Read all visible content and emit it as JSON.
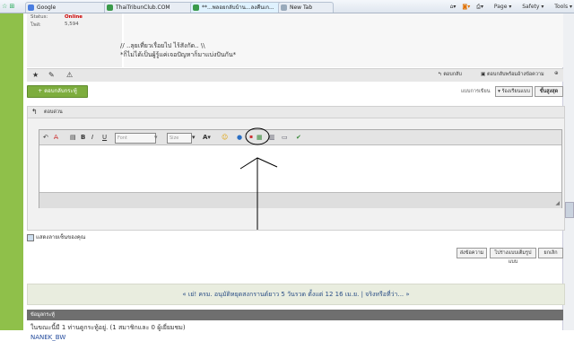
{
  "browser": {
    "tabs": [
      {
        "label": "Google"
      },
      {
        "label": "ThaiTribunClub.COM"
      },
      {
        "label": "**...พลอยกลับบ้าน...ลงคืนเก..."
      },
      {
        "label": "New Tab"
      }
    ],
    "tools": [
      "Page",
      "Safety",
      "Tools"
    ]
  },
  "user_panel": {
    "status_label": "Status:",
    "status_value": "Online",
    "posts_label": "โพส:",
    "posts_value": "5,594"
  },
  "signature": {
    "line1": "// ..ลุยเที่ยวเรื่อยไป ไร้สังกัด.. \\\\",
    "line2": "*ก็ไม่ได้เป็นผู้รู้แค่เจอปัญหาก็มาแบ่งปันกัน*"
  },
  "post_bar": {
    "quote_label": "ตอบกลับ",
    "multi_quote_label": "ตอบกลับพร้อมอ้างข้อความ"
  },
  "actions": {
    "new_reply_label": "+ ตอบกลับกระทู้",
    "mode_label": "แบบการเขียน",
    "mode_basic": "▾ ร้องเรียนแบบ",
    "mode_advanced": "ขั้นสูงสุด"
  },
  "quick_reply": {
    "title": "ตอบด่วน"
  },
  "editor_toolbar": {
    "font_placeholder": "Font",
    "size_placeholder": "Size"
  },
  "options": {
    "show_signature_label": "แสดงลายเซ็นของคุณ"
  },
  "buttons": {
    "post": "ส่งข้อความ",
    "advanced": "ไปร่างแบบเต็มรูปแบบ",
    "cancel": "ยกเลิก"
  },
  "news": {
    "text": "« เย่! ครม. อนุมัติหยุดสงกรานต์ยาว 5 วันรวด ตั้งแต่ 12 16 เม.ย. | จริงหรือที่ว่า... »"
  },
  "who_is_online": {
    "header": "ข้อมูลกระทู้",
    "summary": "ในขณะนี้มี 1 ท่านดูกระทู้อยู่. (1 สมาชิกและ 0 ผู้เยี่ยมชม)",
    "user": "NANEK_BW"
  },
  "colors": {
    "accent_green": "#8fc04a",
    "button_green": "#7dad3e",
    "link_blue": "#2b4f86",
    "status_red": "#cc0000"
  }
}
